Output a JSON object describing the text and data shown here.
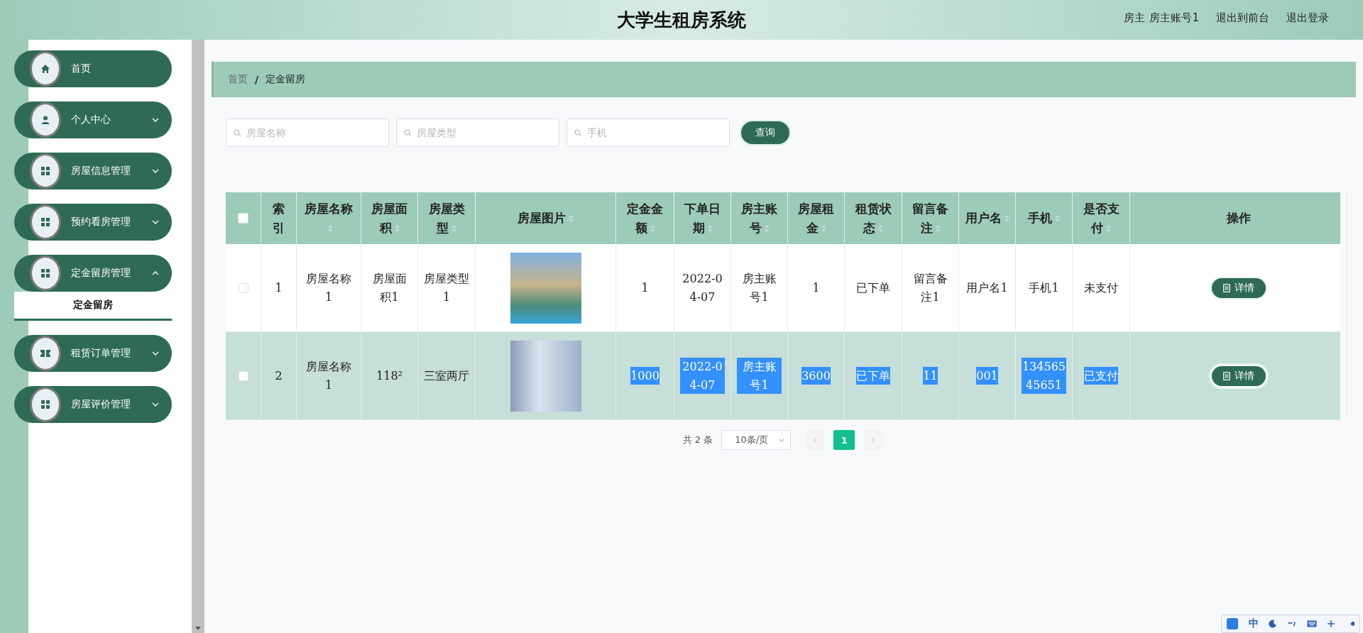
{
  "header": {
    "title": "大学生租房系统",
    "role": "房主",
    "account": "房主账号1",
    "links": [
      "退出到前台",
      "退出登录"
    ]
  },
  "sidebar": {
    "items": [
      {
        "label": "首页"
      },
      {
        "label": "个人中心",
        "expanded": false
      },
      {
        "label": "房屋信息管理",
        "expanded": false
      },
      {
        "label": "预约看房管理",
        "expanded": false
      },
      {
        "label": "定金留房管理",
        "expanded": true,
        "children": [
          {
            "label": "定金留房",
            "selected": true
          }
        ]
      },
      {
        "label": "租赁订单管理",
        "expanded": false
      },
      {
        "label": "房屋评价管理",
        "expanded": false
      }
    ]
  },
  "breadcrumb": {
    "items": [
      "首页",
      "定金留房"
    ],
    "separator": "/"
  },
  "search": {
    "fields": [
      {
        "placeholder": "房屋名称"
      },
      {
        "placeholder": "房屋类型"
      },
      {
        "placeholder": "手机"
      }
    ],
    "button": "查询"
  },
  "table": {
    "all_checked": false,
    "columns": [
      {
        "label": "索引",
        "sortable": false
      },
      {
        "label": "房屋名称",
        "sortable": true
      },
      {
        "label": "房屋面积",
        "sortable": true
      },
      {
        "label": "房屋类型",
        "sortable": true
      },
      {
        "label": "房屋图片",
        "sortable": true
      },
      {
        "label": "定金金额",
        "sortable": true
      },
      {
        "label": "下单日期",
        "sortable": true
      },
      {
        "label": "房主账号",
        "sortable": true
      },
      {
        "label": "房屋租金",
        "sortable": true
      },
      {
        "label": "租赁状态",
        "sortable": true
      },
      {
        "label": "留言备注",
        "sortable": true
      },
      {
        "label": "用户名",
        "sortable": true
      },
      {
        "label": "手机",
        "sortable": true
      },
      {
        "label": "是否支付",
        "sortable": true
      },
      {
        "label": "操作",
        "sortable": false
      }
    ],
    "rows": [
      {
        "checked": false,
        "hovered": false,
        "text_selected": false,
        "cells": [
          "1",
          "房屋名称1",
          "房屋面积1",
          "房屋类型1",
          "",
          "1",
          "2022-04-07",
          "房主账号1",
          "1",
          "已下单",
          "留言备注1",
          "用户名1",
          "手机1",
          "未支付",
          "详情"
        ]
      },
      {
        "checked": false,
        "hovered": true,
        "text_selected": true,
        "cells": [
          "2",
          "房屋名称1",
          "118²",
          "三室两厅",
          "",
          "1000",
          "2022-04-07",
          "房主账号1",
          "3600",
          "已下单",
          "11",
          "001",
          "13456545651",
          "已支付",
          "详情"
        ]
      }
    ]
  },
  "pagination": {
    "total": "共 2 条",
    "page_size": "10条/页",
    "pages": [
      {
        "label": "1",
        "selected": true
      }
    ]
  },
  "ime_bar": {
    "mode": "中"
  }
}
